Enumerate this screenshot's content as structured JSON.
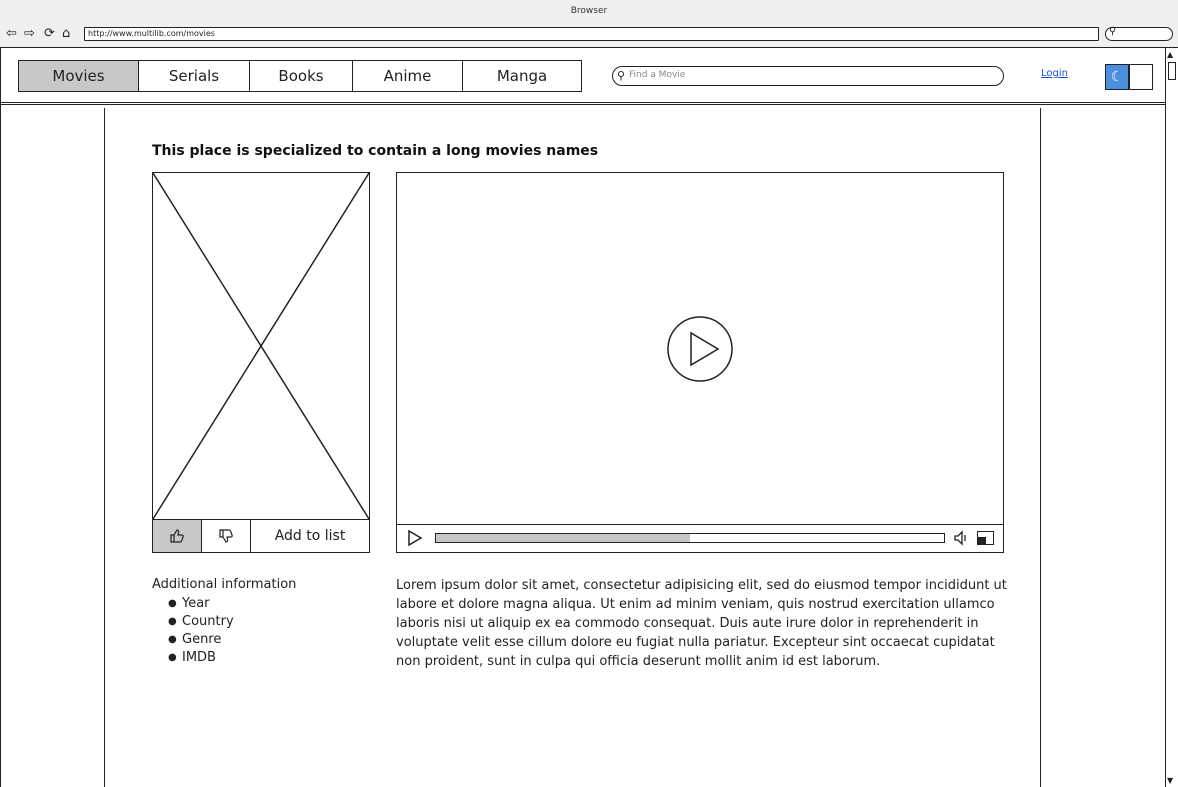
{
  "browser": {
    "title": "Browser",
    "url": "http://www.multilib.com/movies"
  },
  "nav": {
    "tabs": [
      {
        "label": "Movies",
        "active": true
      },
      {
        "label": "Serials",
        "active": false
      },
      {
        "label": "Books",
        "active": false
      },
      {
        "label": "Anime",
        "active": false
      },
      {
        "label": "Manga",
        "active": false
      }
    ],
    "search_placeholder": "Find a Movie",
    "login_label": "Login",
    "theme_toggle": {
      "state": "dark",
      "dark_color": "#4a8fe0"
    }
  },
  "movie": {
    "title": "This place is specialized to contain a long movies names",
    "actions": {
      "like_icon": "thumbs-up-icon",
      "dislike_icon": "thumbs-down-icon",
      "add_to_list_label": "Add to list"
    },
    "player": {
      "progress": 0.5
    },
    "additional_info": {
      "heading": "Additional information",
      "items": [
        "Year",
        "Country",
        "Genre",
        "IMDB"
      ]
    },
    "description": "Lorem ipsum dolor sit amet, consectetur adipisicing elit, sed do eiusmod tempor incididunt ut labore et dolore magna aliqua. Ut enim ad minim veniam, quis nostrud exercitation ullamco laboris nisi ut aliquip ex ea commodo consequat. Duis aute irure dolor in reprehenderit in voluptate velit esse cillum dolore eu fugiat nulla pariatur. Excepteur sint occaecat cupidatat non proident, sunt in culpa qui officia deserunt mollit anim id est laborum."
  }
}
